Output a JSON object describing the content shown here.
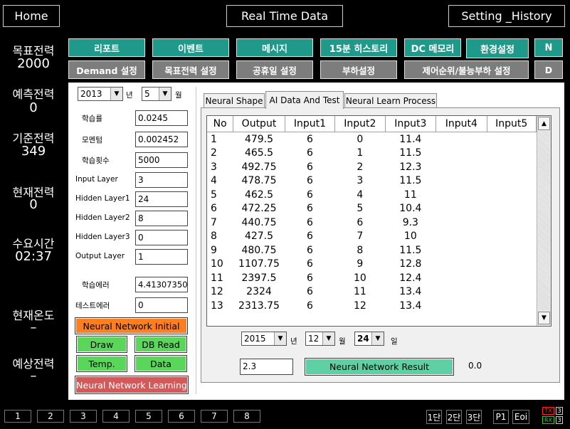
{
  "top": {
    "home": "Home",
    "title": "Real Time Data",
    "setting": "Setting _History"
  },
  "left": {
    "target_power_label": "목표전력",
    "target_power": "2000",
    "forecast_power_label": "예측전력",
    "forecast_power": "0",
    "base_power_label": "기준전력",
    "base_power": "349",
    "current_power_label": "현재전력",
    "current_power": "0",
    "demand_time_label": "수요시간",
    "demand_time": "02:37",
    "current_temp_label": "현재온도",
    "current_temp": "–",
    "expected_power_label": "예상전력",
    "expected_power": "–"
  },
  "nav": {
    "row1": [
      "리포트",
      "이벤트",
      "메시지",
      "15분 히스토리",
      "DC 메모리",
      "환경설정",
      "N"
    ],
    "row2": [
      "Demand 설정",
      "목표전력 설정",
      "공휴일 설정",
      "부하설정",
      "제어순위/불능부하 설정",
      "D"
    ]
  },
  "form": {
    "year": "2013",
    "year_unit": "년",
    "month": "5",
    "month_unit": "월",
    "fields": [
      {
        "label": "학습률",
        "value": "0.0245"
      },
      {
        "label": "모멘텀",
        "value": "0.002452"
      },
      {
        "label": "학습횟수",
        "value": "5000"
      },
      {
        "label": "Input Layer",
        "value": "3"
      },
      {
        "label": "Hidden Layer1",
        "value": "24"
      },
      {
        "label": "Hidden Layer2",
        "value": "8"
      },
      {
        "label": "Hidden Layer3",
        "value": "0"
      },
      {
        "label": "Output Layer",
        "value": "1"
      },
      {
        "label": "학습에러",
        "value": "4.41307350"
      },
      {
        "label": "테스트에러",
        "value": "0"
      }
    ],
    "btn_initial": "Neural Network Initial",
    "btn_draw": "Draw",
    "btn_dbread": "DB Read",
    "btn_temp": "Temp.",
    "btn_data": "Data",
    "btn_learning": "Neural Network Learning"
  },
  "tabs": [
    "Neural Shape",
    "AI Data And Test",
    "Neural Learn Process"
  ],
  "grid": {
    "columns": [
      "No",
      "Output",
      "Input1",
      "Input2",
      "Input3",
      "Input4",
      "Input5"
    ],
    "rows": [
      [
        "1",
        "479.5",
        "6",
        "0",
        "11.4"
      ],
      [
        "2",
        "465.5",
        "6",
        "1",
        "11.5"
      ],
      [
        "3",
        "492.75",
        "6",
        "2",
        "12.3"
      ],
      [
        "4",
        "478.75",
        "6",
        "3",
        "11.5"
      ],
      [
        "5",
        "462.5",
        "6",
        "4",
        "11"
      ],
      [
        "6",
        "472.25",
        "6",
        "5",
        "10.4"
      ],
      [
        "7",
        "440.75",
        "6",
        "6",
        "9.3"
      ],
      [
        "8",
        "427.5",
        "6",
        "7",
        "10"
      ],
      [
        "9",
        "480.75",
        "6",
        "8",
        "11.5"
      ],
      [
        "10",
        "1107.75",
        "6",
        "9",
        "12.8"
      ],
      [
        "11",
        "2397.5",
        "6",
        "10",
        "12.4"
      ],
      [
        "12",
        "2324",
        "6",
        "11",
        "13.4"
      ],
      [
        "13",
        "2313.75",
        "6",
        "12",
        "13.4"
      ]
    ]
  },
  "test": {
    "year": "2015",
    "year_unit": "년",
    "month": "12",
    "month_unit": "월",
    "day": "24",
    "day_unit": "일",
    "temp_value": "2.3",
    "btn_result": "Neural Network Result",
    "result": "0.0"
  },
  "bottom": {
    "pages": [
      "1",
      "2",
      "3",
      "4",
      "5",
      "6",
      "7",
      "8"
    ],
    "stage1": "1단",
    "stage2": "2단",
    "stage3": "3단",
    "p1": "P1",
    "eoi": "Eoi",
    "tx": "TX",
    "tx_count": "3",
    "rx": "RX",
    "rx_count": "3"
  }
}
